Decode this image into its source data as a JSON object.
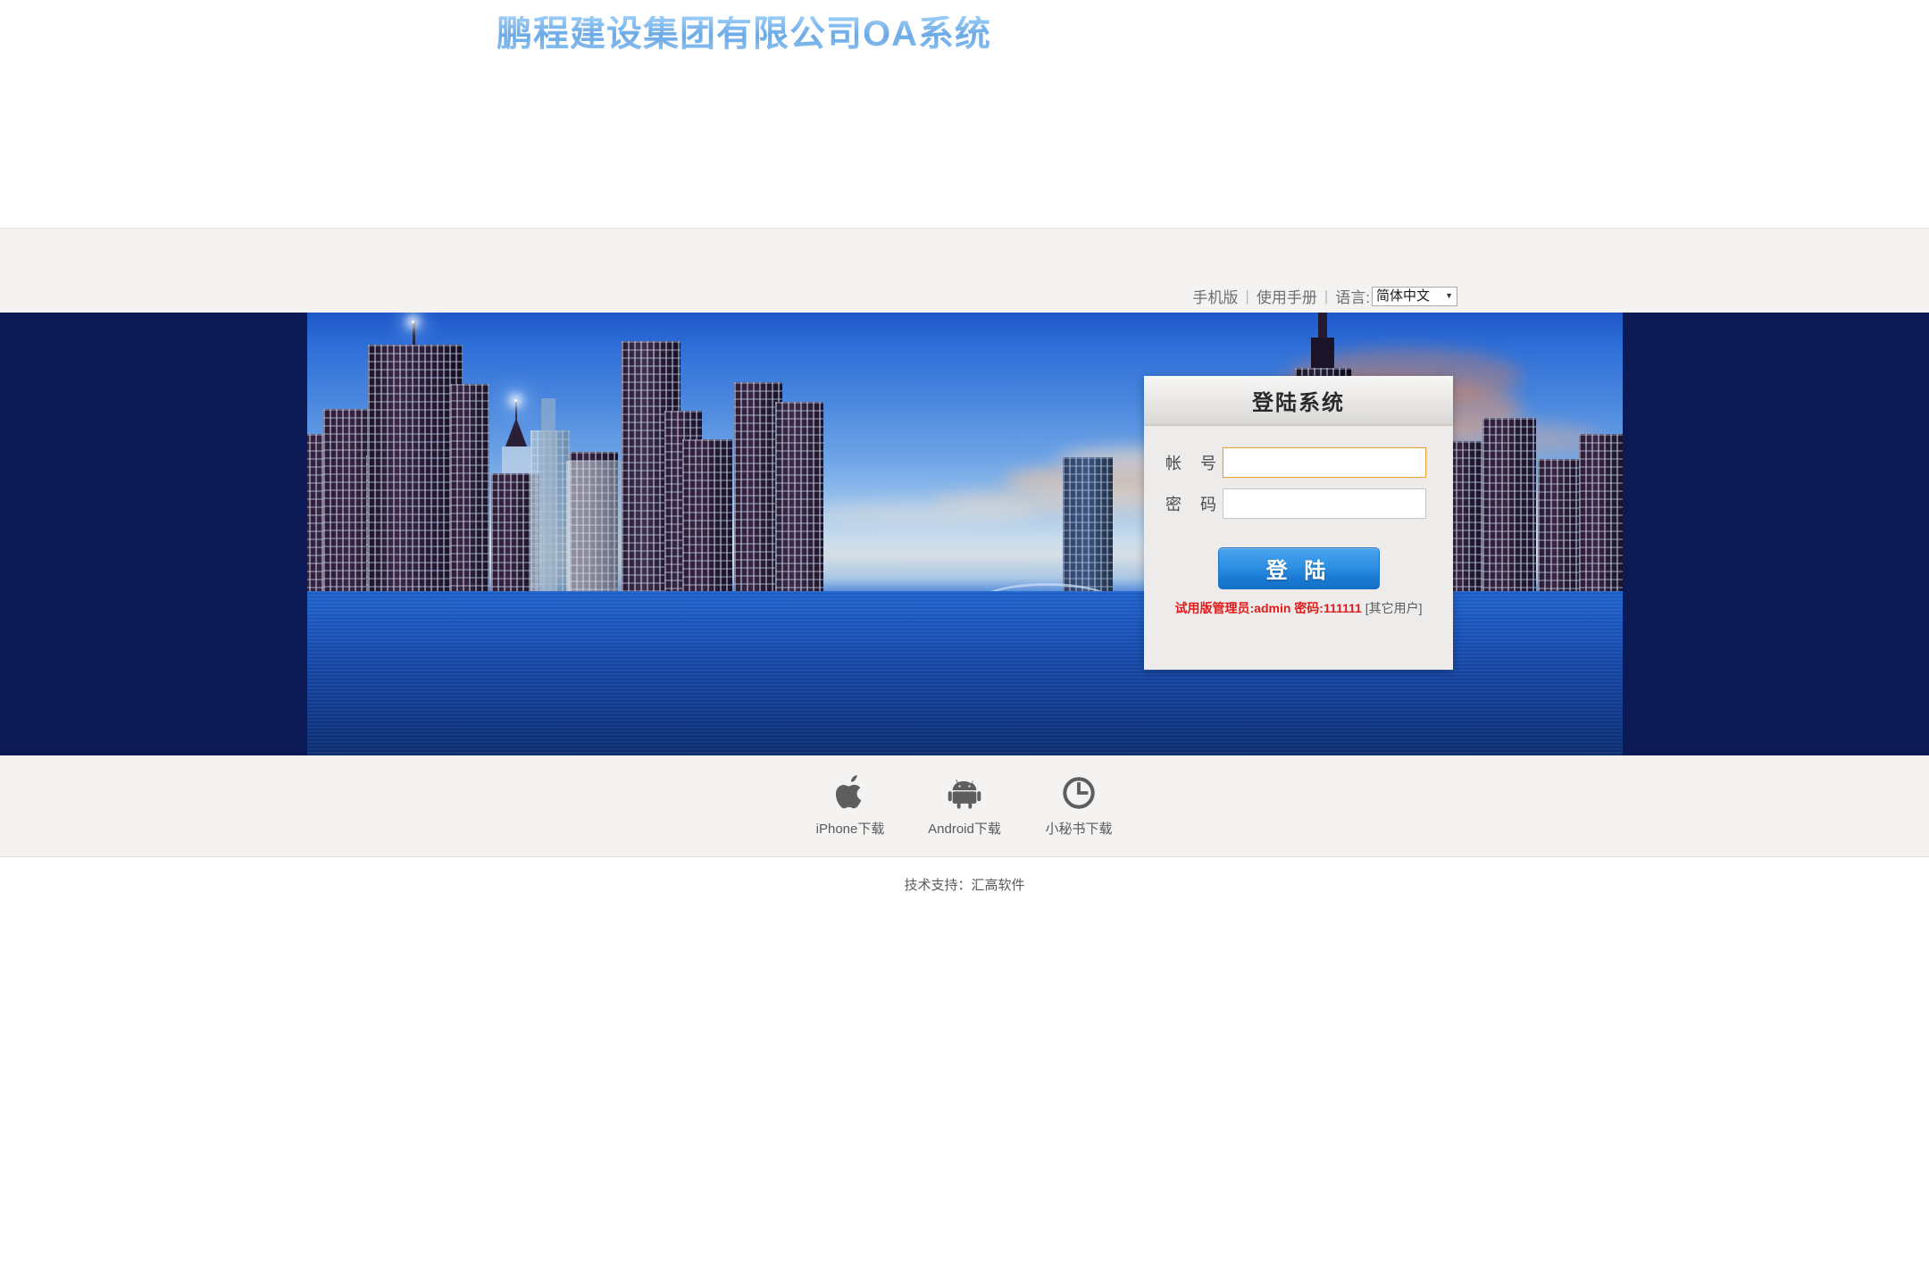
{
  "header": {
    "title": "鹏程建设集团有限公司OA系统",
    "nav": {
      "mobile": "手机版",
      "manual": "使用手册",
      "sep": "|",
      "lang_label": "语言:",
      "lang_value": "简体中文",
      "lang_options": [
        "简体中文"
      ],
      "arrow_icon": "▼"
    }
  },
  "login": {
    "heading": "登陆系统",
    "account_label": "帐 号",
    "account_value": "",
    "account_placeholder": "",
    "password_label": "密 码",
    "password_value": "",
    "password_placeholder": "",
    "submit_label": "登 陆",
    "hint_main": "试用版管理员:admin 密码:111111",
    "hint_other": "[其它用户]"
  },
  "downloads": [
    {
      "icon": "apple-icon",
      "label": "iPhone下载"
    },
    {
      "icon": "android-icon",
      "label": "Android下载"
    },
    {
      "icon": "clock-icon",
      "label": "小秘书下载"
    }
  ],
  "footer": {
    "support_text": "技术支持：汇高软件"
  },
  "colors": {
    "header_bg": "#f4f3f1",
    "title_blue": "#79b4ec",
    "banner_navy": "#0b1a54",
    "button_blue": "#2e91e4",
    "hint_red": "#e01b1b",
    "focus_orange": "#e8a33d"
  }
}
